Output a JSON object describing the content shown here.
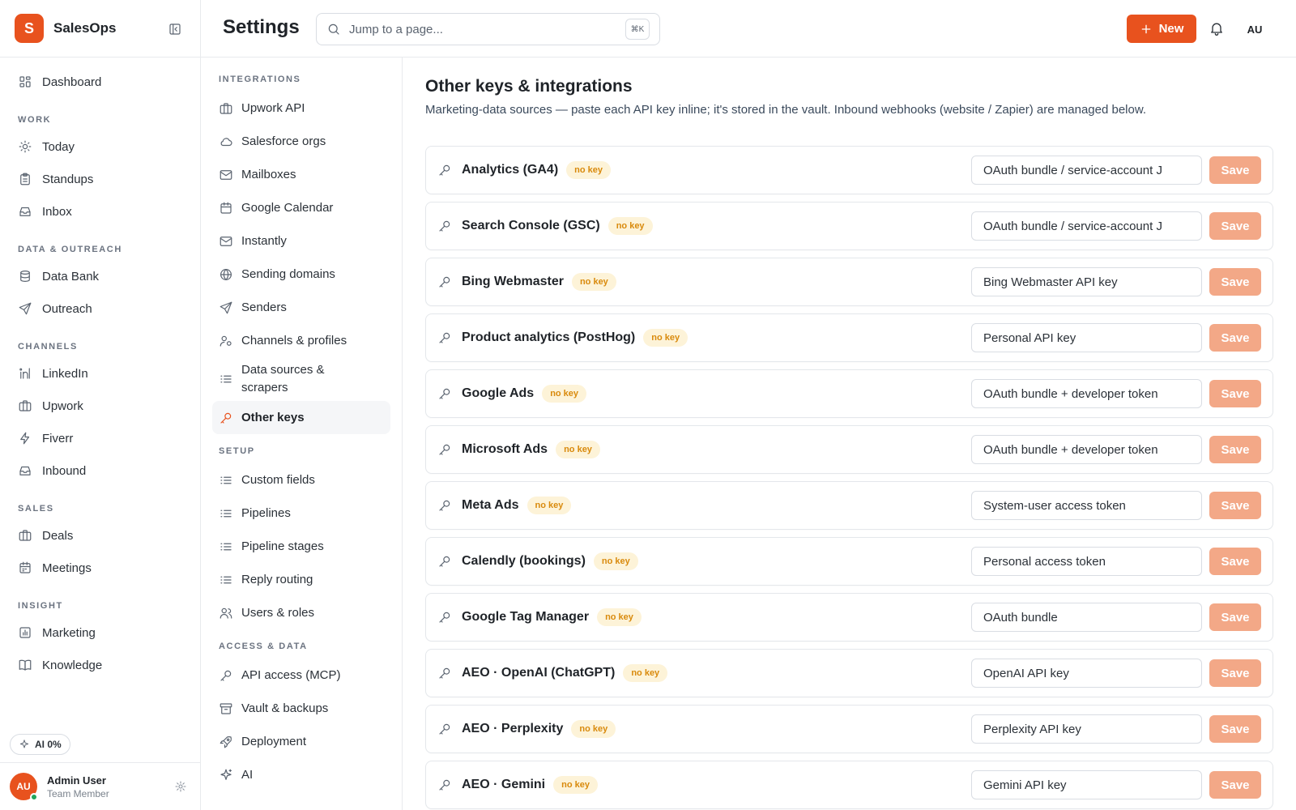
{
  "app": {
    "logo_letter": "S",
    "name": "SalesOps"
  },
  "sidebar": {
    "dashboard": "Dashboard",
    "sections": [
      {
        "title": "WORK",
        "items": [
          {
            "label": "Today",
            "icon": "sun-icon"
          },
          {
            "label": "Standups",
            "icon": "clipboard-icon"
          },
          {
            "label": "Inbox",
            "icon": "inbox-icon"
          }
        ]
      },
      {
        "title": "DATA & OUTREACH",
        "items": [
          {
            "label": "Data Bank",
            "icon": "database-icon"
          },
          {
            "label": "Outreach",
            "icon": "send-icon"
          }
        ]
      },
      {
        "title": "CHANNELS",
        "items": [
          {
            "label": "LinkedIn",
            "icon": "linkedin-icon"
          },
          {
            "label": "Upwork",
            "icon": "briefcase-icon"
          },
          {
            "label": "Fiverr",
            "icon": "bolt-icon"
          },
          {
            "label": "Inbound",
            "icon": "inbox-icon"
          }
        ]
      },
      {
        "title": "SALES",
        "items": [
          {
            "label": "Deals",
            "icon": "briefcase-icon"
          },
          {
            "label": "Meetings",
            "icon": "calendar-icon"
          }
        ]
      },
      {
        "title": "INSIGHT",
        "items": [
          {
            "label": "Marketing",
            "icon": "chart-icon"
          },
          {
            "label": "Knowledge",
            "icon": "book-icon"
          }
        ]
      }
    ],
    "ai_pill": "AI 0%",
    "user": {
      "initials": "AU",
      "name": "Admin User",
      "role": "Team Member"
    }
  },
  "topbar": {
    "title": "Settings",
    "search_placeholder": "Jump to a page...",
    "shortcut": "⌘K",
    "new_label": "New",
    "avatar": "AU"
  },
  "settings_nav": {
    "integrations_title": "INTEGRATIONS",
    "integrations": [
      "Upwork API",
      "Salesforce orgs",
      "Mailboxes",
      "Google Calendar",
      "Instantly",
      "Sending domains",
      "Senders",
      "Channels & profiles",
      "Data sources & scrapers",
      "Other keys"
    ],
    "setup_title": "SETUP",
    "setup": [
      "Custom fields",
      "Pipelines",
      "Pipeline stages",
      "Reply routing",
      "Users & roles"
    ],
    "access_title": "ACCESS & DATA",
    "access": [
      "API access (MCP)",
      "Vault & backups",
      "Deployment",
      "AI"
    ]
  },
  "main": {
    "title": "Other keys & integrations",
    "subtitle": "Marketing-data sources — paste each API key inline; it's stored in the vault. Inbound webhooks (website / Zapier) are managed below.",
    "badge": "no key",
    "save_label": "Save",
    "integrations": [
      {
        "name": "Analytics (GA4)",
        "placeholder": "OAuth bundle / service-account J"
      },
      {
        "name": "Search Console (GSC)",
        "placeholder": "OAuth bundle / service-account J"
      },
      {
        "name": "Bing Webmaster",
        "placeholder": "Bing Webmaster API key"
      },
      {
        "name": "Product analytics (PostHog)",
        "placeholder": "Personal API key"
      },
      {
        "name": "Google Ads",
        "placeholder": "OAuth bundle + developer token"
      },
      {
        "name": "Microsoft Ads",
        "placeholder": "OAuth bundle + developer token"
      },
      {
        "name": "Meta Ads",
        "placeholder": "System-user access token"
      },
      {
        "name": "Calendly (bookings)",
        "placeholder": "Personal access token"
      },
      {
        "name": "Google Tag Manager",
        "placeholder": "OAuth bundle"
      },
      {
        "name": "AEO · OpenAI (ChatGPT)",
        "placeholder": "OpenAI API key"
      },
      {
        "name": "AEO · Perplexity",
        "placeholder": "Perplexity API key"
      },
      {
        "name": "AEO · Gemini",
        "placeholder": "Gemini API key"
      }
    ]
  },
  "colors": {
    "accent": "#e8521e",
    "save_disabled": "#f3a887",
    "badge_bg": "#fdf3d8",
    "badge_text": "#d98a0c"
  }
}
